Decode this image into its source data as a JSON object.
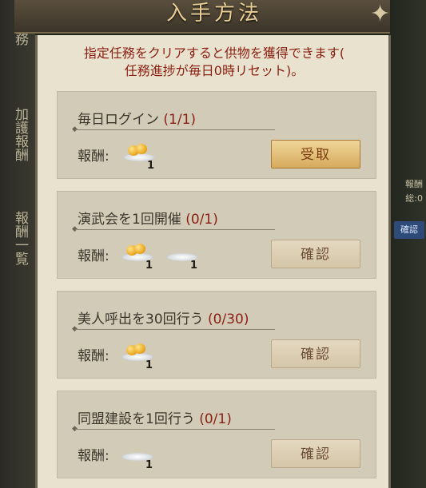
{
  "header": {
    "title": "入手方法"
  },
  "sidebar": {
    "tabs": [
      "任務",
      "加護報酬",
      "報酬一覧"
    ]
  },
  "right_edge": {
    "label_1": "報酬",
    "label_2": "総:0",
    "badge": "確認"
  },
  "intro": {
    "line1": "指定任務をクリアすると供物を獲得できます(",
    "line2": "任務進捗が毎日0時リセット)。"
  },
  "reward_label": "報酬:",
  "tasks": [
    {
      "name": "毎日ログイン",
      "progress": "(1/1)",
      "button": "受取",
      "rewards": [
        {
          "type": "fruit-plate",
          "count": "1"
        }
      ]
    },
    {
      "name": "演武会を1回開催",
      "progress": "(0/1)",
      "button": "確認",
      "rewards": [
        {
          "type": "fruit-plate",
          "count": "1"
        },
        {
          "type": "empty-plate",
          "count": "1"
        }
      ]
    },
    {
      "name": "美人呼出を30回行う",
      "progress": "(0/30)",
      "button": "確認",
      "rewards": [
        {
          "type": "fruit-plate",
          "count": "1"
        }
      ]
    },
    {
      "name": "同盟建設を1回行う",
      "progress": "(0/1)",
      "button": "確認",
      "rewards": [
        {
          "type": "empty-plate",
          "count": "1"
        }
      ]
    }
  ]
}
